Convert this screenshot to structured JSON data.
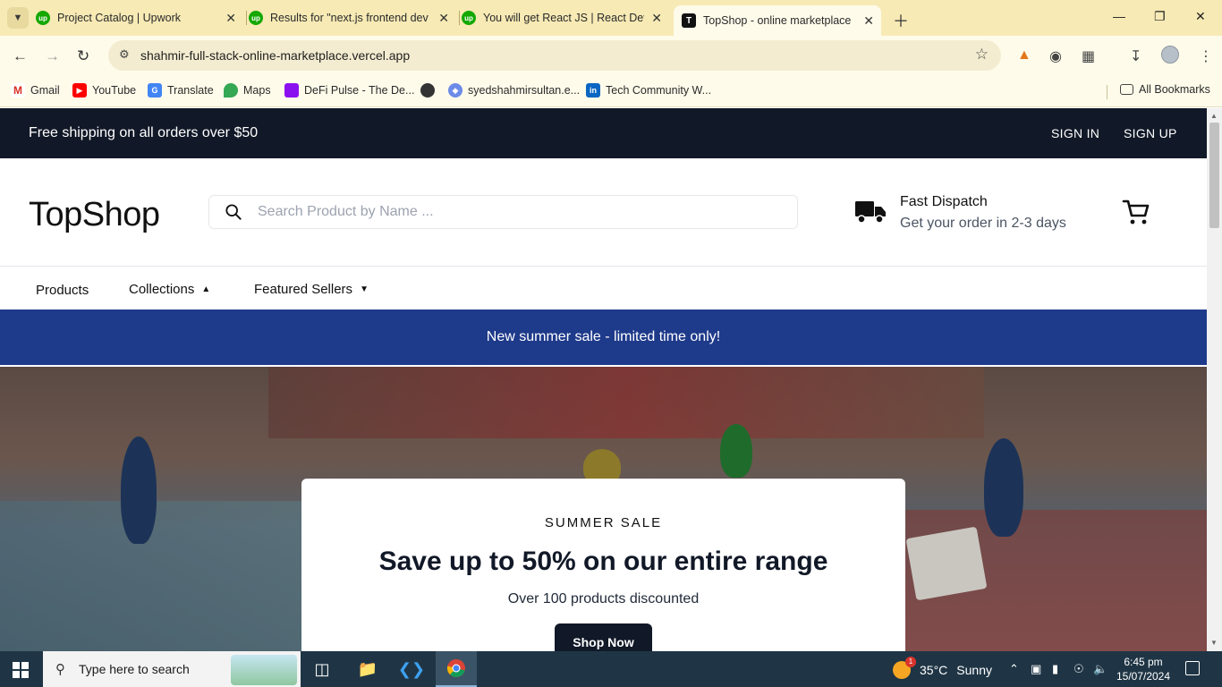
{
  "browser": {
    "tabs": [
      {
        "title": "Project Catalog | Upwork",
        "favicon": "upwork-icon"
      },
      {
        "title": "Results for \"next.js frontend dev",
        "favicon": "upwork-icon"
      },
      {
        "title": "You will get React JS | React Dev",
        "favicon": "upwork-icon"
      },
      {
        "title": "TopShop - online marketplace",
        "favicon": "topshop-icon",
        "active": true
      }
    ],
    "url": "shahmir-full-stack-online-marketplace.vercel.app",
    "bookmarks": [
      {
        "label": "Gmail",
        "icon": "gmail-icon"
      },
      {
        "label": "YouTube",
        "icon": "youtube-icon"
      },
      {
        "label": "Translate",
        "icon": "translate-icon"
      },
      {
        "label": "Maps",
        "icon": "maps-icon"
      },
      {
        "label": "DeFi Pulse - The De...",
        "icon": "defi-pulse-icon"
      },
      {
        "label": "",
        "icon": "globe-icon"
      },
      {
        "label": "syedshahmirsultan.e...",
        "icon": "site-icon"
      },
      {
        "label": "Tech Community W...",
        "icon": "linkedin-icon"
      }
    ],
    "all_bookmarks_label": "All Bookmarks"
  },
  "announcement": {
    "message": "Free shipping on all orders over $50",
    "sign_in": "SIGN IN",
    "sign_up": "SIGN UP"
  },
  "header": {
    "logo": "TopShop",
    "search_placeholder": "Search Product by Name ...",
    "dispatch_title": "Fast Dispatch",
    "dispatch_subtitle": "Get your order in 2-3 days"
  },
  "nav": {
    "products": "Products",
    "collections": "Collections",
    "featured_sellers": "Featured Sellers"
  },
  "promo_banner": "New summer sale - limited time only!",
  "hero": {
    "kicker": "SUMMER SALE",
    "title": "Save up to 50% on our entire range",
    "subtitle": "Over 100 products discounted",
    "button": "Shop Now"
  },
  "taskbar": {
    "search_text": "Type here to search",
    "weather_temp": "35°C",
    "weather_cond": "Sunny",
    "weather_badge": "1",
    "time": "6:45 pm",
    "date": "15/07/2024"
  },
  "colors": {
    "announcement_bg": "#111827",
    "promo_bg": "#1e3a8a",
    "tabstrip_bg": "#f7eab5",
    "taskbar_bg": "#1f3545"
  }
}
